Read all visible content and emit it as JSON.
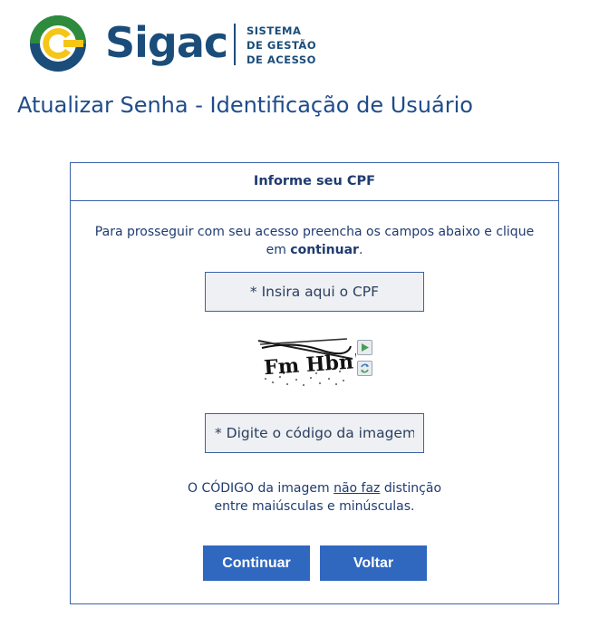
{
  "logo": {
    "wordmark": "Sigac",
    "subtitle_lines": [
      "SISTEMA",
      "DE GESTÃO",
      "DE ACESSO"
    ],
    "colors": {
      "blue": "#1b4d7a",
      "green": "#2e8b3e",
      "yellow": "#f5c518"
    }
  },
  "page": {
    "title": "Atualizar Senha - Identificação de Usuário"
  },
  "panel": {
    "header": "Informe seu CPF",
    "instructions_before": "Para prosseguir com seu acesso preencha os campos abaixo e clique em ",
    "instructions_bold": "continuar",
    "instructions_after": "."
  },
  "form": {
    "cpf_placeholder": "* Insira aqui o CPF",
    "captcha_placeholder": "* Digite o código da imagem",
    "captcha_text": "Fm Hbn!",
    "captcha_audio_icon": "play-audio-icon",
    "captcha_refresh_icon": "refresh-icon"
  },
  "note": {
    "before": "O CÓDIGO da imagem ",
    "underlined": "não faz",
    "after_line1": " distinção",
    "line2": "entre maiúsculas e minúsculas."
  },
  "buttons": {
    "continue": "Continuar",
    "back": "Voltar"
  },
  "colors": {
    "accent": "#3068c0",
    "border": "#3b62a8",
    "text": "#1f3b70"
  }
}
